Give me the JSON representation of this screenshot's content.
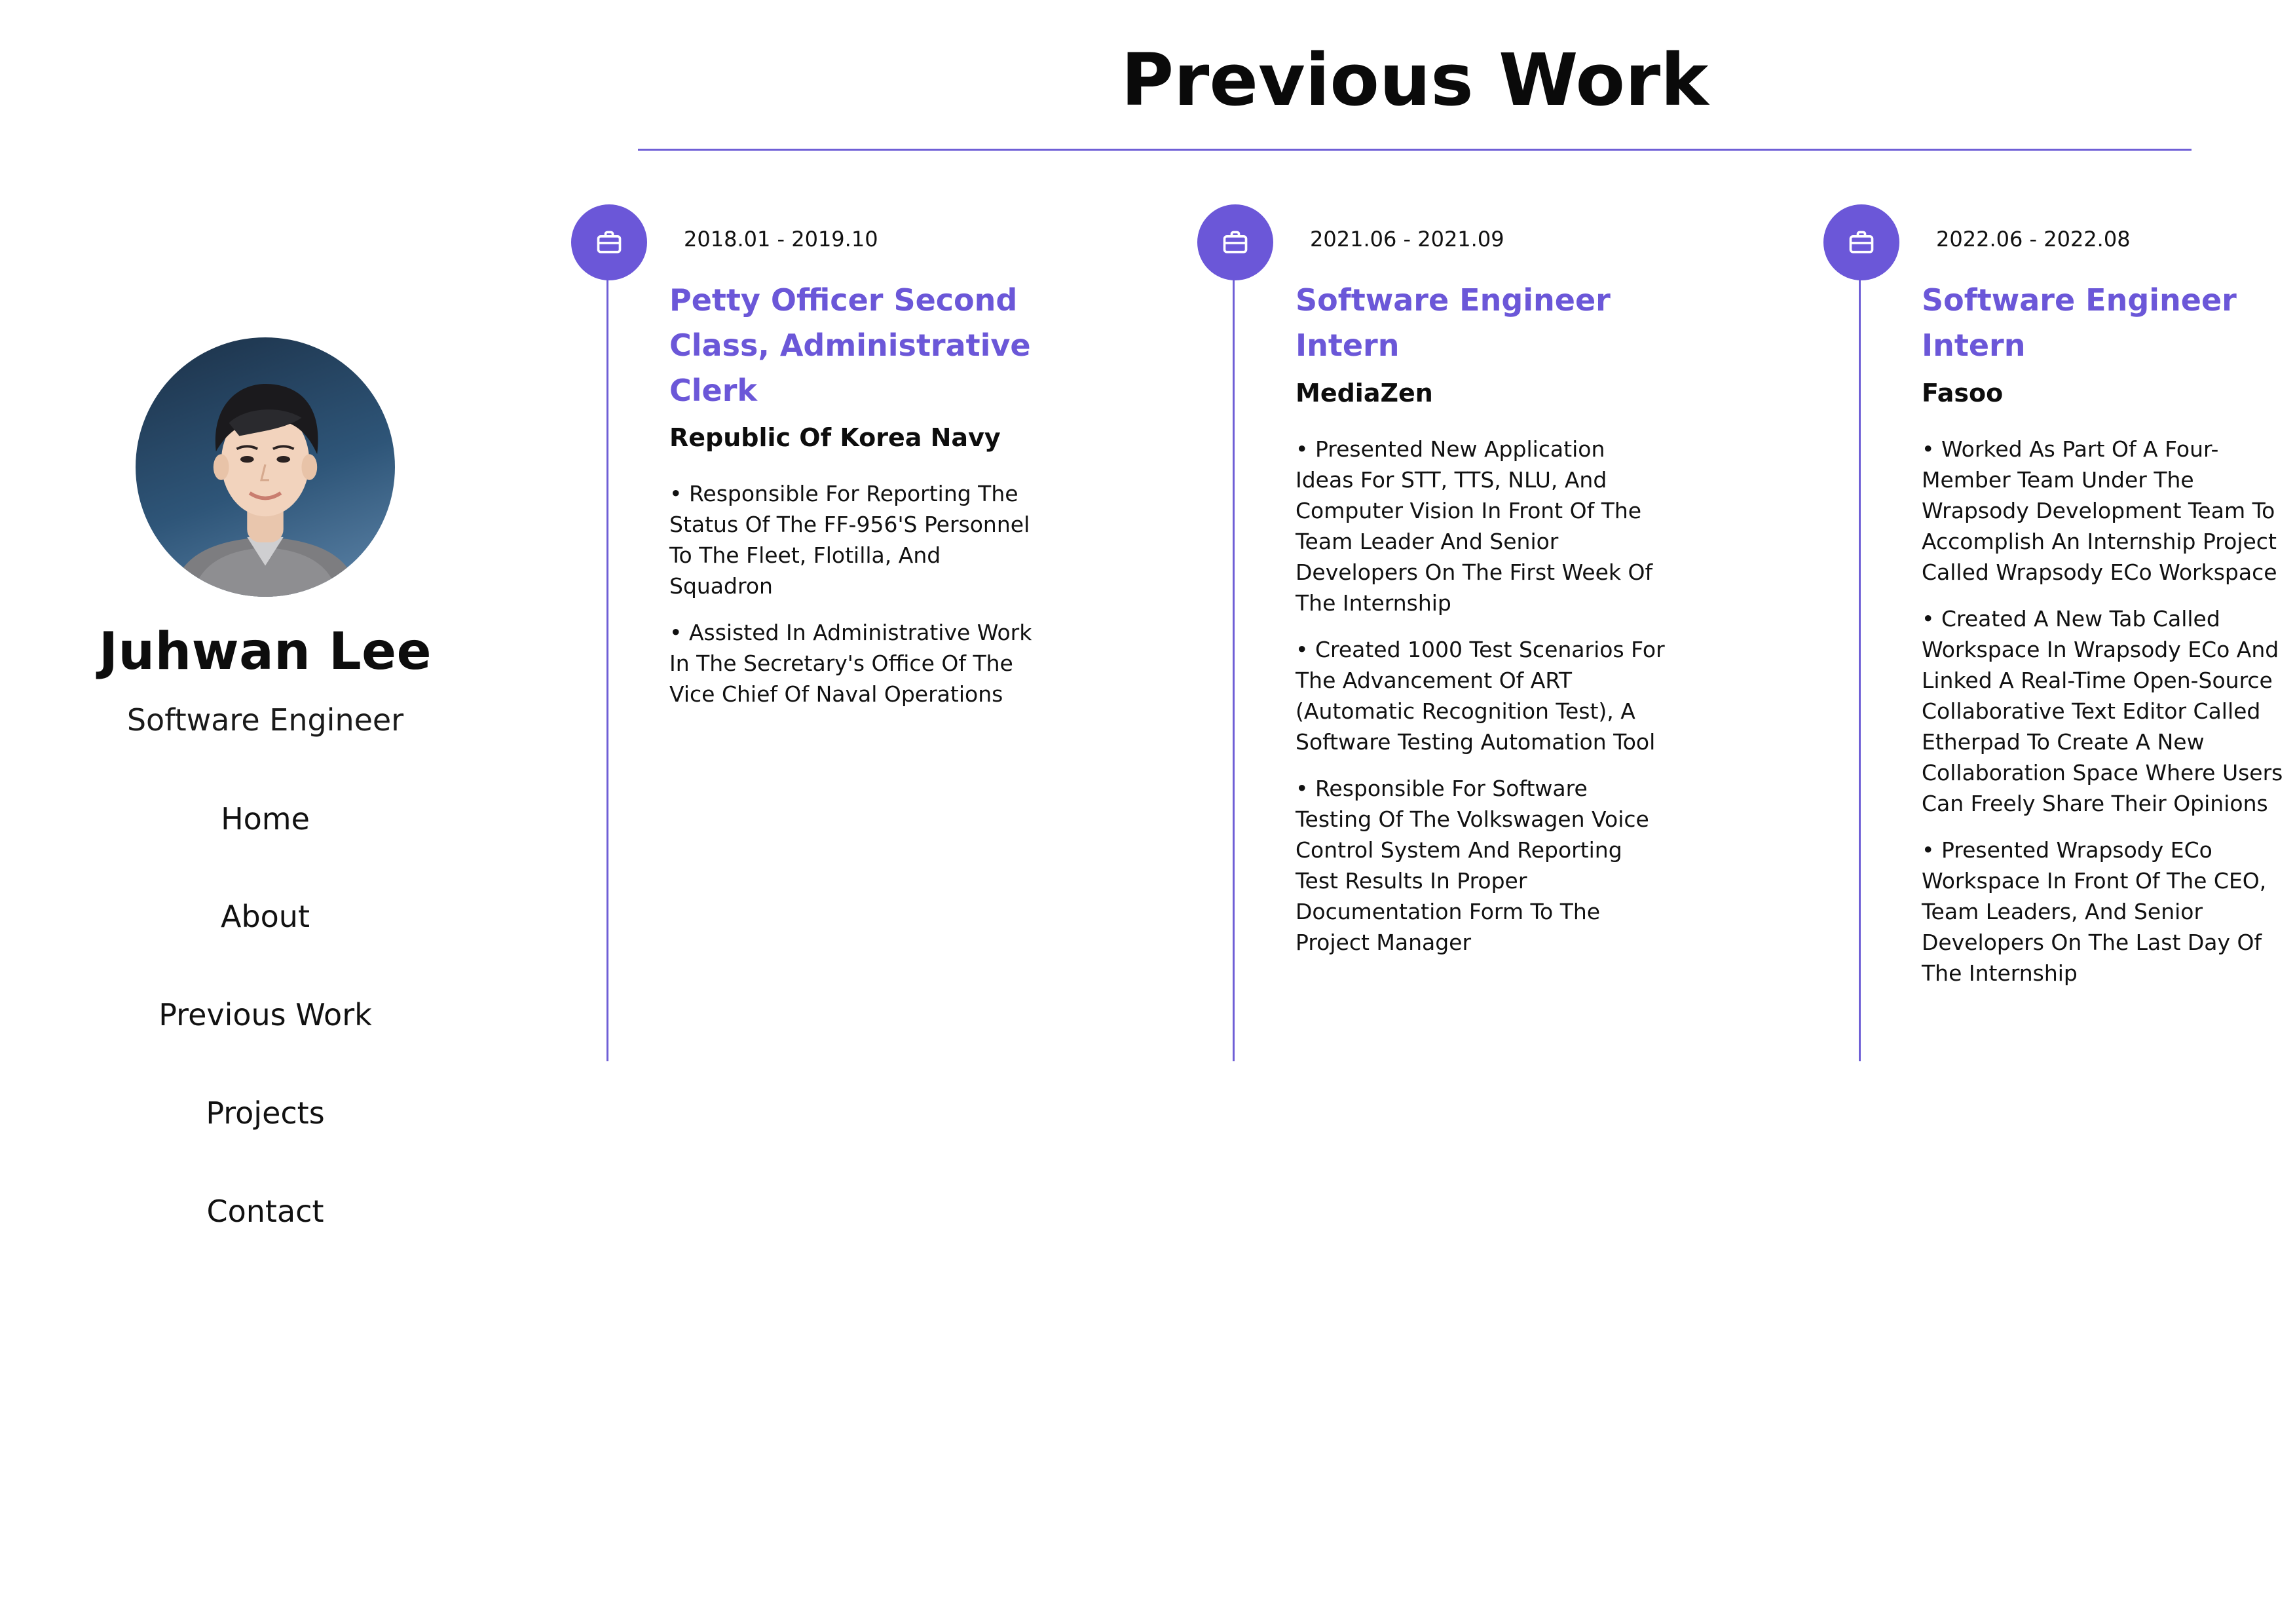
{
  "theme": {
    "accent": "#6b57d8",
    "text": "#111111",
    "background": "#ffffff"
  },
  "sidebar": {
    "name": "Juhwan Lee",
    "role": "Software Engineer",
    "nav": [
      {
        "label": "Home"
      },
      {
        "label": "About"
      },
      {
        "label": "Previous Work"
      },
      {
        "label": "Projects"
      },
      {
        "label": "Contact"
      }
    ]
  },
  "main": {
    "title": "Previous Work",
    "jobs": [
      {
        "icon": "briefcase-icon",
        "date": "2018.01 - 2019.10",
        "title": "Petty Officer Second Class, Administrative Clerk",
        "company": "Republic Of Korea Navy",
        "bullets": [
          "• Responsible For Reporting The Status Of The FF-956'S Personnel To The Fleet, Flotilla, And Squadron",
          "• Assisted In Administrative Work In The Secretary's Office Of The Vice Chief Of Naval Operations"
        ]
      },
      {
        "icon": "briefcase-icon",
        "date": "2021.06 - 2021.09",
        "title": "Software Engineer Intern",
        "company": "MediaZen",
        "bullets": [
          "• Presented New Application Ideas For STT, TTS, NLU, And Computer Vision In Front Of The Team Leader And Senior Developers On The First Week Of The Internship",
          "• Created 1000 Test Scenarios For The Advancement Of ART (Automatic Recognition Test), A Software Testing Automation Tool",
          "• Responsible For Software Testing Of The Volkswagen Voice Control System And Reporting Test Results In Proper Documentation Form To The Project Manager"
        ]
      },
      {
        "icon": "briefcase-icon",
        "date": "2022.06 - 2022.08",
        "title": "Software Engineer Intern",
        "company": "Fasoo",
        "bullets": [
          "• Worked As Part Of A Four-Member Team Under The Wrapsody Development Team To Accomplish An Internship Project Called Wrapsody ECo Workspace",
          "• Created A New Tab Called Workspace In Wrapsody ECo And Linked A Real-Time Open-Source Collaborative Text Editor Called Etherpad To Create A New Collaboration Space Where Users Can Freely Share Their Opinions",
          "• Presented Wrapsody ECo Workspace In Front Of The CEO, Team Leaders, And Senior Developers On The Last Day Of The Internship"
        ]
      }
    ]
  }
}
